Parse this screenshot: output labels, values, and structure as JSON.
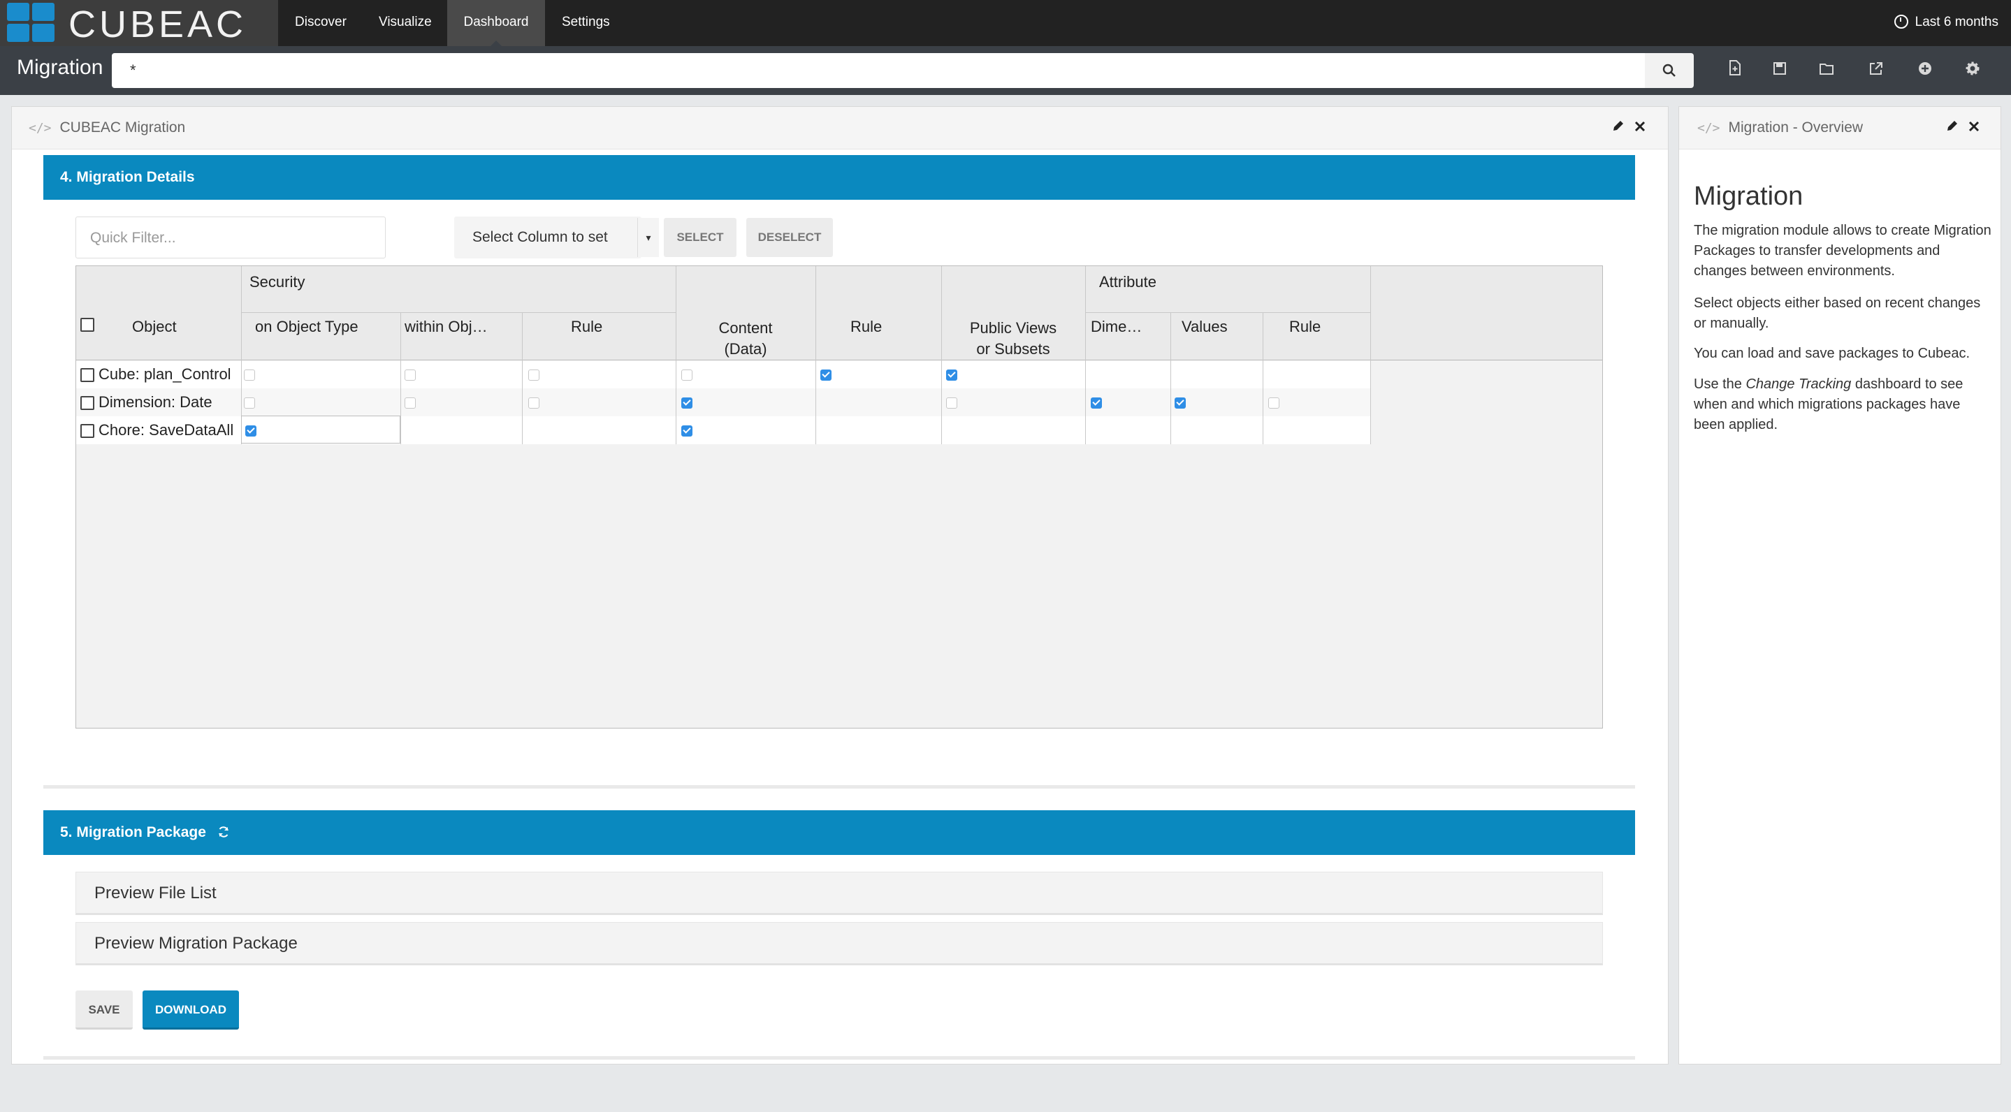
{
  "app": {
    "logo_text": "CUBEAC",
    "nav_tabs": [
      {
        "label": "Discover"
      },
      {
        "label": "Visualize"
      },
      {
        "label": "Dashboard"
      },
      {
        "label": "Settings"
      }
    ],
    "active_tab": "Dashboard",
    "time_filter": "Last 6 months",
    "brand_color": "#0a89bf"
  },
  "query_bar": {
    "title": "Migration",
    "query": "*",
    "icons": [
      "search-icon",
      "new-dashboard-icon",
      "save-icon",
      "open-icon",
      "share-icon",
      "add-panel-icon",
      "options-icon"
    ]
  },
  "main_panel": {
    "title": "CUBEAC Migration",
    "details": {
      "heading": "4. Migration Details",
      "quick_filter_placeholder": "Quick Filter...",
      "select_column": "Select Column to set",
      "select_label": "SELECT",
      "deselect_label": "DESELECT",
      "groups": {
        "security": "Security",
        "attribute": "Attribute"
      },
      "columns": {
        "object": "Object",
        "on_object_type": "on Object Type",
        "within_obj": "within Obj…",
        "sec_rule": "Rule",
        "content_l1": "Content",
        "content_l2": "(Data)",
        "rule": "Rule",
        "pv_l1": "Public Views",
        "pv_l2": "or Subsets",
        "dime": "Dime…",
        "values": "Values",
        "attr_rule": "Rule"
      },
      "rows": [
        {
          "object": "Cube: plan_Control"
        },
        {
          "object": "Dimension: Date"
        },
        {
          "object": "Chore: SaveDataAll"
        }
      ]
    },
    "package": {
      "heading": "5. Migration Package",
      "preview_file_list": "Preview File List",
      "preview_package": "Preview Migration Package",
      "save_label": "SAVE",
      "download_label": "DOWNLOAD"
    }
  },
  "overview_panel": {
    "title": "Migration - Overview",
    "heading": "Migration",
    "p1": "The migration module allows to create Migration Packages to transfer developments and changes between environments.",
    "p2": "Select objects either based on recent changes or manually.",
    "p3": "You can load and save packages to Cubeac.",
    "p4_pre": "Use the ",
    "p4_em": "Change Tracking",
    "p4_post": " dashboard to see when and which migrations packages have been applied."
  }
}
